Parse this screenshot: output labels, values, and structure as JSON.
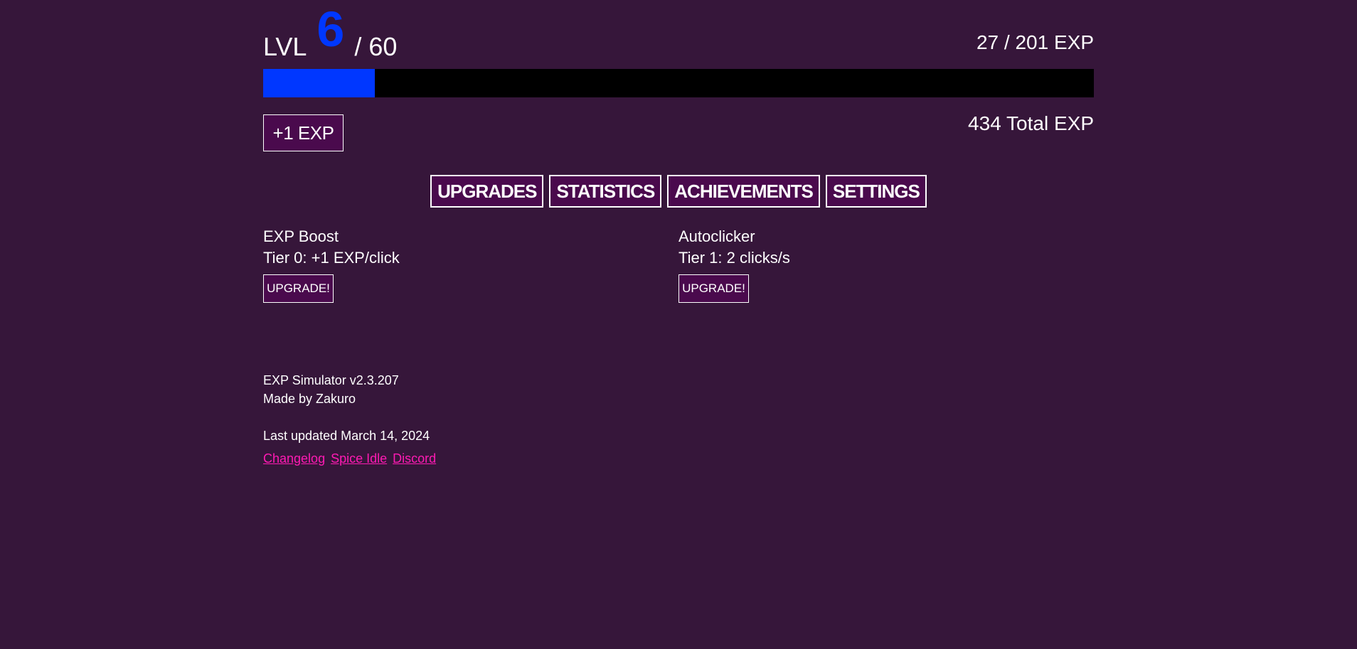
{
  "level": {
    "prefix": "LVL",
    "current": "6",
    "max_text": "/ 60"
  },
  "exp": {
    "progress_text": "27 / 201 EXP",
    "progress_fraction": 0.134,
    "total_text": "434 Total EXP",
    "click_button": "+1 EXP"
  },
  "tabs": [
    {
      "label": "UPGRADES"
    },
    {
      "label": "STATISTICS"
    },
    {
      "label": "ACHIEVEMENTS"
    },
    {
      "label": "SETTINGS"
    }
  ],
  "upgrades": [
    {
      "name": "EXP Boost",
      "tier": "Tier 0: +1 EXP/click",
      "button": "UPGRADE!"
    },
    {
      "name": "Autoclicker",
      "tier": "Tier 1: 2 clicks/s",
      "button": "UPGRADE!"
    }
  ],
  "footer": {
    "version": "EXP Simulator v2.3.207",
    "author": "Made by Zakuro",
    "updated": "Last updated March 14, 2024",
    "links": [
      {
        "label": "Changelog"
      },
      {
        "label": "Spice Idle"
      },
      {
        "label": "Discord"
      }
    ]
  },
  "colors": {
    "background": "#36163a",
    "accent": "#0037ff",
    "button_bg": "#4a0a4d",
    "link": "#ff1ab3"
  }
}
